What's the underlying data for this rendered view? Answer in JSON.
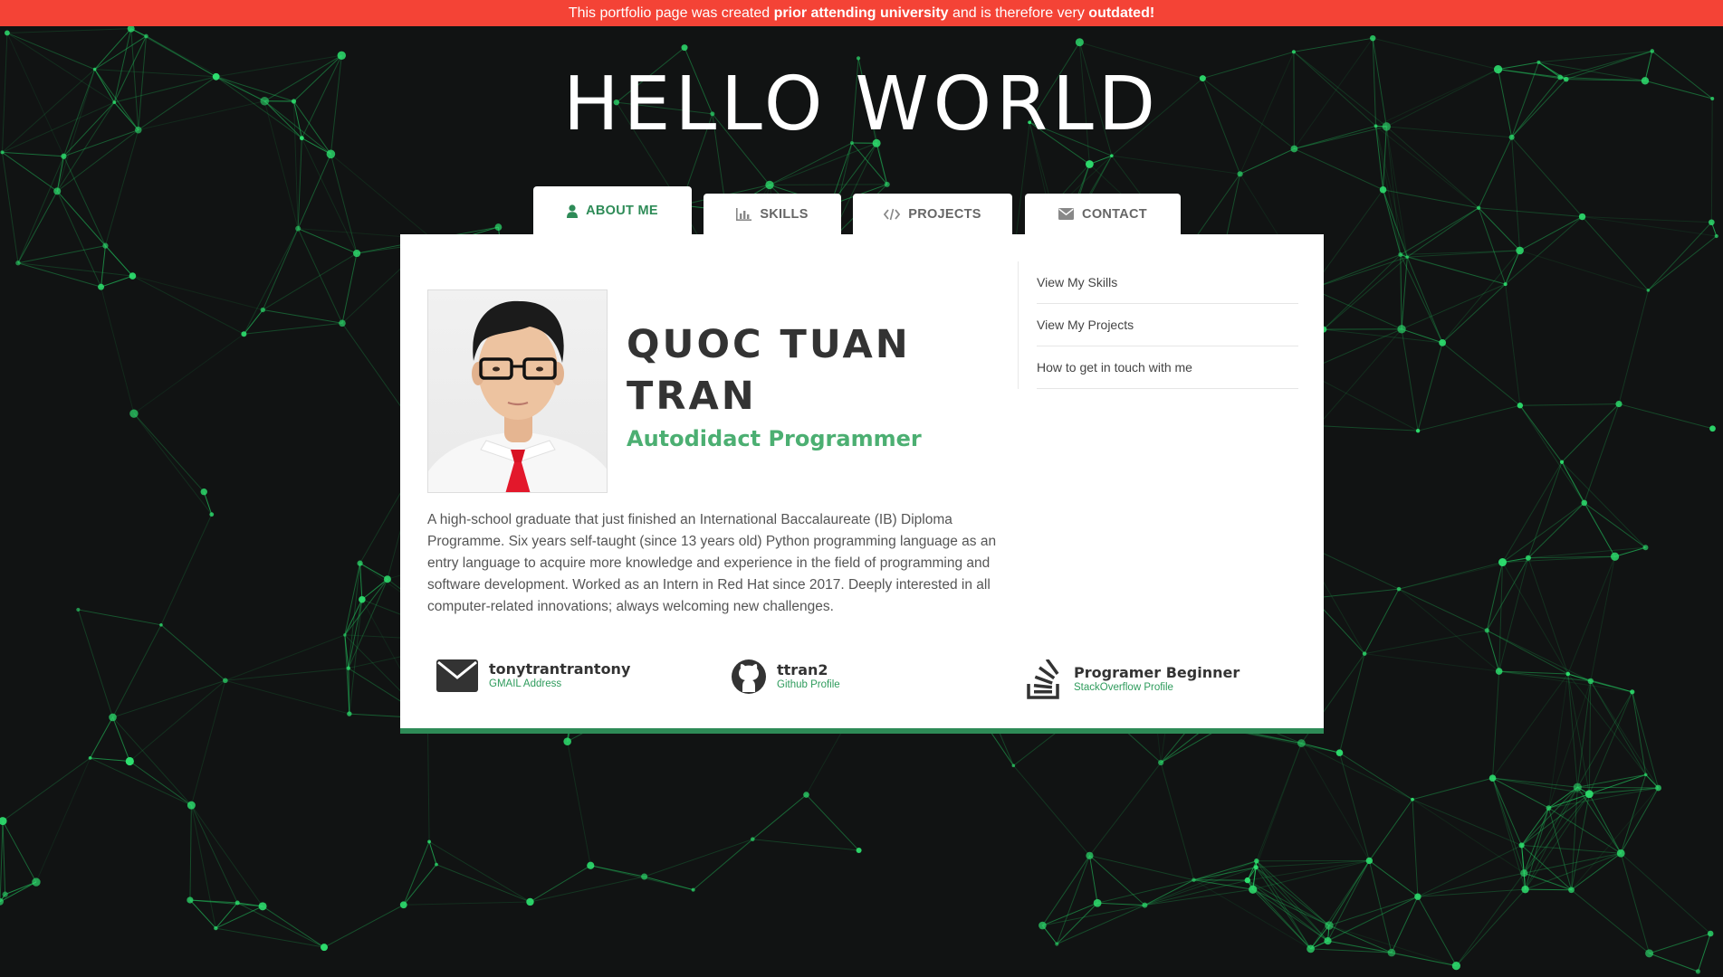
{
  "banner": {
    "part1": "This portfolio page was created ",
    "bold1": "prior attending university",
    "part2": " and is therefore very ",
    "bold2": "outdated!"
  },
  "hero": {
    "title": "HELLO WORLD"
  },
  "tabs": [
    {
      "label": "ABOUT ME",
      "icon": "user-icon",
      "active": true
    },
    {
      "label": "SKILLS",
      "icon": "bar-chart-icon",
      "active": false
    },
    {
      "label": "PROJECTS",
      "icon": "code-icon",
      "active": false
    },
    {
      "label": "CONTACT",
      "icon": "envelope-icon",
      "active": false
    }
  ],
  "profile": {
    "name_line1": "QUOC TUAN",
    "name_line2": "TRAN",
    "role": "Autodidact Programmer",
    "bio": "A high-school graduate that just finished an International Baccalaureate (IB) Diploma Programme. Six years self-taught (since 13 years old) Python programming language as an entry language to acquire more knowledge and experience in the field of programming and software development. Worked as an Intern in Red Hat since 2017. Deeply interested in all computer-related innovations; always welcoming new challenges."
  },
  "side_links": [
    "View My Skills",
    "View My Projects",
    "How to get in touch with me"
  ],
  "contacts": [
    {
      "title": "tonytrantrantony",
      "subtitle": "GMAIL Address",
      "icon": "envelope-icon"
    },
    {
      "title": "ttran2",
      "subtitle": "Github Profile",
      "icon": "github-icon"
    },
    {
      "title": "Programer Beginner",
      "subtitle": "StackOverflow Profile",
      "icon": "stackoverflow-icon"
    }
  ],
  "colors": {
    "banner": "#f44336",
    "background": "#111313",
    "accent_green": "#2e8b57",
    "role_green": "#4caf72",
    "network_line": "#22c55e"
  }
}
